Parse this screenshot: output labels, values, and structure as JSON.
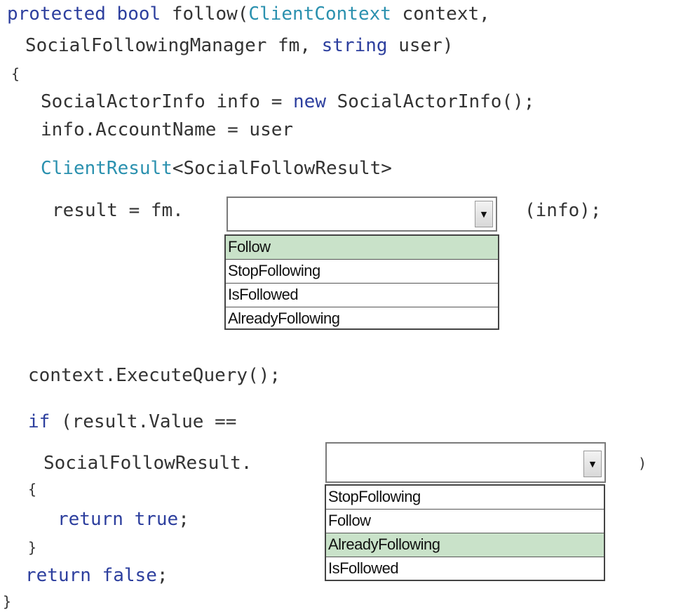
{
  "code": {
    "l1": {
      "kw1": "protected",
      "kw2": "bool",
      "p1": " follow(",
      "t1": "ClientContext",
      "p2": " context,"
    },
    "l2": {
      "p1": "SocialFollowingManager fm, ",
      "kw1": "string",
      "p2": " user)"
    },
    "l3": "{",
    "l4": {
      "p1": "SocialActorInfo info = ",
      "kw1": "new",
      "p2": " SocialActorInfo();"
    },
    "l5": "info.AccountName = user",
    "l6": {
      "t1": "ClientResult",
      "p1": "<SocialFollowResult>"
    },
    "l7a": "result = fm.",
    "l7b": "(info);",
    "l8": "context.ExecuteQuery();",
    "l9": {
      "kw1": "if",
      "p1": " (result.Value =="
    },
    "l10a": "SocialFollowResult.",
    "l10b": ")",
    "l11": "{",
    "l12": {
      "kw1": "return",
      "kw2": "true",
      "p1": ";"
    },
    "l13": "}",
    "l14": {
      "kw1": "return",
      "kw2": "false",
      "p1": ";"
    },
    "l15": "}"
  },
  "dropdown1": {
    "value": "",
    "options": [
      "Follow",
      "StopFollowing",
      "IsFollowed",
      "AlreadyFollowing"
    ],
    "highlighted": "Follow"
  },
  "dropdown2": {
    "value": "",
    "options": [
      "StopFollowing",
      "Follow",
      "AlreadyFollowing",
      "IsFollowed"
    ],
    "highlighted": "AlreadyFollowing"
  },
  "icons": {
    "dropdown_arrow": "chevron-down-icon",
    "arrow_glyph": "▼"
  },
  "colors": {
    "keyword": "#2d3f9e",
    "type": "#2b91af",
    "selected_option": "#c9e2c9"
  }
}
